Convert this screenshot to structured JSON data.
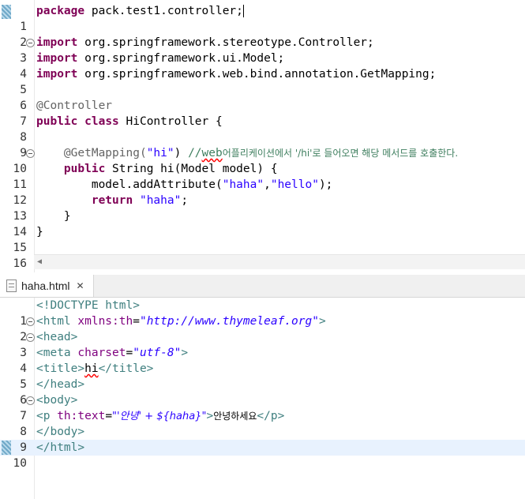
{
  "java_editor": {
    "lines": [
      {
        "n": "1"
      },
      {
        "n": "2"
      },
      {
        "n": "3"
      },
      {
        "n": "4"
      },
      {
        "n": "5"
      },
      {
        "n": "6"
      },
      {
        "n": "7"
      },
      {
        "n": "8"
      },
      {
        "n": "9"
      },
      {
        "n": "10"
      },
      {
        "n": "11"
      },
      {
        "n": "12"
      },
      {
        "n": "13"
      },
      {
        "n": "14"
      },
      {
        "n": "15"
      },
      {
        "n": "16"
      }
    ],
    "t": {
      "package_kw": "package",
      "package_name": " pack.test1.controller;",
      "import_kw": "import",
      "import1": " org.springframework.stereotype.Controller;",
      "import2": " org.springframework.ui.Model;",
      "import3": " org.springframework.web.bind.annotation.GetMapping;",
      "controller_ann": "@Controller",
      "public_kw": "public",
      "class_kw": "class",
      "class_name": " HiController {",
      "getmapping_ann": "@GetMapping(",
      "getmapping_arg": "\"hi\"",
      "getmapping_close": ") ",
      "comment_start": "//",
      "comment_web": "web",
      "comment_rest": "어플리케이션에서 '/hi'로 들어오면 해당 메서드를 호출한다.",
      "method_sig": " String hi(Model model) {",
      "model_call": "model.addAttribute(",
      "arg_haha": "\"haha\"",
      "comma": ",",
      "arg_hello": "\"hello\"",
      "call_close": ");",
      "return_kw": "return",
      "return_val": "\"haha\"",
      "semicolon": ";",
      "close_method": "}",
      "close_class": "}"
    }
  },
  "html_editor": {
    "tab_label": "haha.html",
    "tab_close": "✕",
    "lines": [
      {
        "n": "1"
      },
      {
        "n": "2"
      },
      {
        "n": "3"
      },
      {
        "n": "4"
      },
      {
        "n": "5"
      },
      {
        "n": "6"
      },
      {
        "n": "7"
      },
      {
        "n": "8"
      },
      {
        "n": "9"
      },
      {
        "n": "10"
      }
    ],
    "t": {
      "doctype": "<!DOCTYPE html>",
      "html_open": "<html ",
      "xmlns_attr": "xmlns:th",
      "eq": "=",
      "xmlns_val": "\"http://www.thymeleaf.org\"",
      "gt": ">",
      "head_open": "<head>",
      "meta_open": "<meta ",
      "charset_attr": "charset",
      "charset_val": "\"utf-8\"",
      "title_open": "<title>",
      "title_text": "hi",
      "title_close": "</title>",
      "head_close": "</head>",
      "body_open": "<body>",
      "p_open": "<p ",
      "thtext_attr": "th:text",
      "thtext_val": "\"'안녕' + ${haha}\"",
      "p_text": "안녕하세요",
      "p_close": "</p>",
      "body_close": "</body>",
      "html_close": "</html>"
    }
  }
}
